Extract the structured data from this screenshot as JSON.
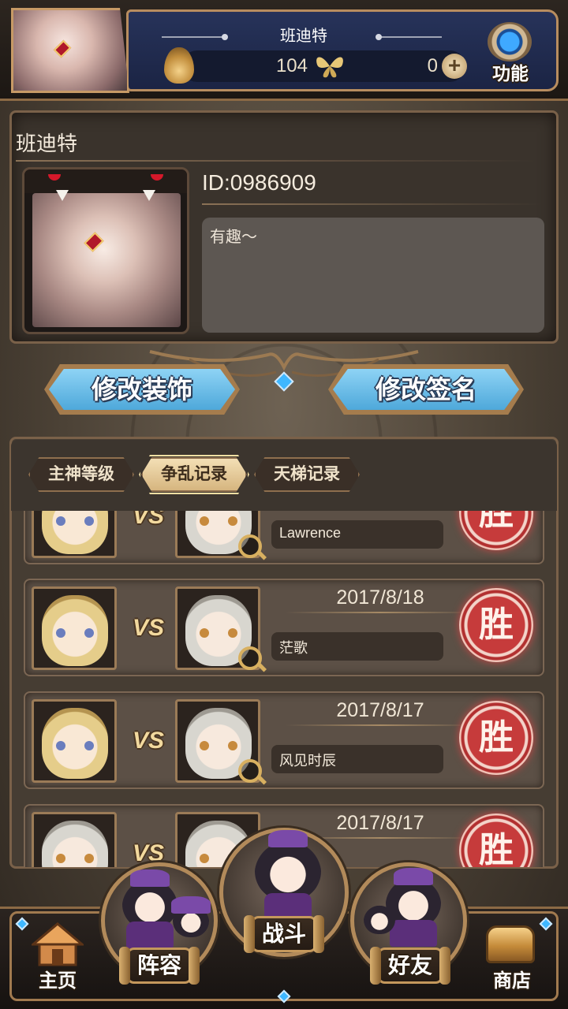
{
  "header": {
    "player_name": "班迪特",
    "currency_a": "104",
    "currency_b": "0",
    "function_label": "功能",
    "icons": {
      "avatar": "player-avatar",
      "resource": "flame-spirit-icon",
      "butterfly": "butterfly-icon",
      "plus": "plus-icon",
      "gear": "gear-icon"
    }
  },
  "profile": {
    "name": "班迪特",
    "id_text": "ID:0986909",
    "signature": "有趣～"
  },
  "actions": {
    "edit_decoration": "修改装饰",
    "edit_signature": "修改签名"
  },
  "tabs": [
    {
      "label": "主神等级",
      "active": false
    },
    {
      "label": "争乱记录",
      "active": true
    },
    {
      "label": "天梯记录",
      "active": false
    }
  ],
  "records": [
    {
      "date": "",
      "opponent": "Lawrence",
      "result": "胜",
      "vs": "VS"
    },
    {
      "date": "2017/8/18",
      "opponent": "茫歌",
      "result": "胜",
      "vs": "VS"
    },
    {
      "date": "2017/8/17",
      "opponent": "风见时辰",
      "result": "胜",
      "vs": "VS"
    },
    {
      "date": "2017/8/17",
      "opponent": "",
      "result": "胜",
      "vs": "VS"
    }
  ],
  "bottom_nav": {
    "home": "主页",
    "team": "阵容",
    "battle": "战斗",
    "friends": "好友",
    "shop": "商店"
  },
  "colors": {
    "accent_gold": "#b88d5f",
    "button_blue": "#5eb4e0",
    "win_red": "#c63b3b"
  }
}
